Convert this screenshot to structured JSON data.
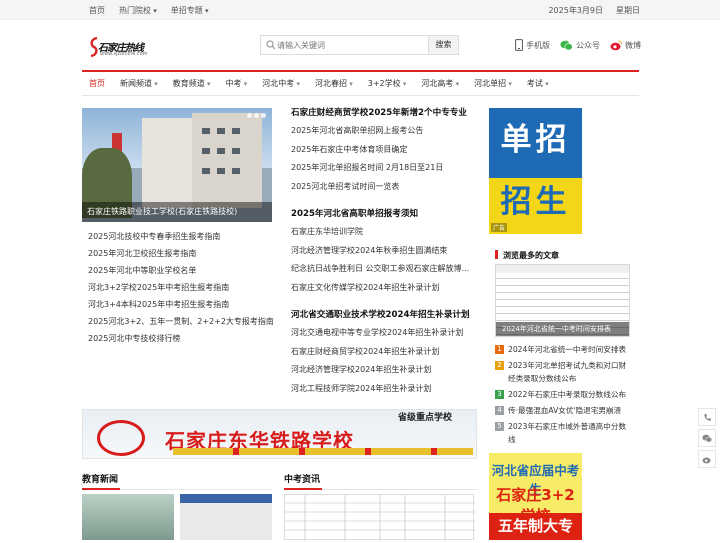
{
  "topbar": {
    "links": [
      "首页",
      "热门院校",
      "单招专题"
    ],
    "date": "2025年3月9日",
    "weekday": "星期日"
  },
  "logo": {
    "text": "石家庄热线",
    "url": "www.sjzonline.com"
  },
  "search": {
    "placeholder": "请输入关键词",
    "button": "搜索"
  },
  "header_links": [
    "手机版",
    "公众号",
    "微博"
  ],
  "nav": [
    "首页",
    "新闻频道",
    "教育频道",
    "中考",
    "河北中考",
    "河北春招",
    "3+2学校",
    "河北高考",
    "河北单招",
    "考试"
  ],
  "slide": {
    "caption": "石家庄铁路职业技工学校(石家庄铁路技校)"
  },
  "left_list": [
    "2025河北技校中专春季招生报考指南",
    "2025年河北卫校招生报考指南",
    "2025年河北中等职业学校名单",
    "河北3+2学校2025年中考招生报考指南",
    "河北3+4本科2025年中考招生报考指南",
    "2025河北3+2、五年一贯制、2+2+2大专报考指南",
    "2025河北中专技校排行榜"
  ],
  "mid": [
    {
      "head": "石家庄财经商贸学校2025年新增2个中专专业",
      "items": [
        "2025年河北省高职单招网上报考公告",
        "2025年石家庄中考体育项目确定",
        "2025年河北单招报名时间 2月18日至21日",
        "2025河北单招考试时间一览表"
      ]
    },
    {
      "head": "2025年河北省高职单招报考须知",
      "items": [
        "石家庄东华培训学院",
        "河北经济管理学校2024年秋季招生圆满结束",
        "纪念抗日战争胜利日 公交职工参观石家庄解放博...",
        "石家庄文化传媒学校2024年招生补录计划"
      ]
    },
    {
      "head": "河北省交通职业技术学校2024年招生补录计划",
      "items": [
        "河北交通电视中等专业学校2024年招生补录计划",
        "石家庄财经商贸学校2024年招生补录计划",
        "河北经济管理学校2024年招生补录计划",
        "河北工程技师学院2024年招生补录计划"
      ]
    }
  ],
  "banner": {
    "top": "省级重点学校",
    "name": "石家庄东华铁路学校"
  },
  "sections": {
    "edu_news": "教育新闻",
    "zhongkao": "中考资讯"
  },
  "right": {
    "ad1": {
      "line1": "单招",
      "line2": "招生",
      "ad": "广告"
    },
    "most_viewed_title": "浏览最多的文章",
    "img_caption": "2024年河北省统一中考时间安排表",
    "list": [
      "2024年河北省统一中考时间安排表",
      "2023年河北单招考试九类和对口财经类录取分数线公布",
      "2022年石家庄中考录取分数线公布",
      "传·最强混血AV女优'隐退宅男崩溃",
      "2023年石家庄市域外普通高中分数线"
    ],
    "ad2": {
      "a": "河北省应届中考生",
      "b": "石家庄3+2学校",
      "c": "五年制大专"
    }
  },
  "colors": {
    "accent": "#dd2222",
    "num": [
      "#e86a0c",
      "#e8a20c",
      "#37a24b",
      "#9aa0a6",
      "#9aa0a6"
    ]
  }
}
